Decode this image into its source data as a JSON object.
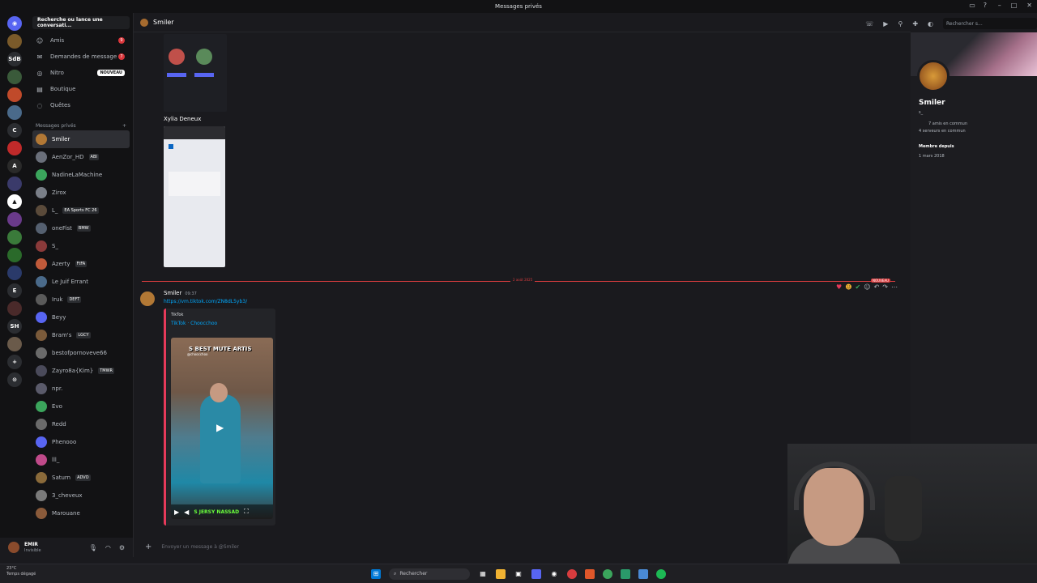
{
  "window": {
    "title": "Messages privés"
  },
  "servers": [
    "SdB",
    "C",
    "E",
    "SH"
  ],
  "sidebar": {
    "search_placeholder": "Recherche ou lance une conversati...",
    "nav": [
      {
        "label": "Amis",
        "badge": "9"
      },
      {
        "label": "Demandes de message",
        "badge": "7"
      },
      {
        "label": "Nitro",
        "badge": "NOUVEAU"
      },
      {
        "label": "Boutique"
      },
      {
        "label": "Quêtes"
      }
    ],
    "section_title": "Messages privés",
    "dms": [
      {
        "name": "Smiler",
        "tag": "",
        "color": "#b27835"
      },
      {
        "name": "AenZor_HD",
        "tag": "ABI",
        "color": "#6a6f7a"
      },
      {
        "name": "NadineLaMachine",
        "tag": "",
        "color": "#3ba55c"
      },
      {
        "name": "Zirox",
        "tag": "",
        "color": "#7a7f88"
      },
      {
        "name": "L_",
        "tag": "EA Sports FC 26",
        "color": "#5a4a3a"
      },
      {
        "name": "oneFist",
        "tag": "BMW",
        "color": "#556070"
      },
      {
        "name": "S_",
        "tag": "",
        "color": "#8a3a3a"
      },
      {
        "name": "Azerty",
        "tag": "FtFA",
        "color": "#c05a3a"
      },
      {
        "name": "Le Juif Errant",
        "tag": "",
        "color": "#4a6a8a"
      },
      {
        "name": "Iruk",
        "tag": "DEFT",
        "color": "#5a5a5a"
      },
      {
        "name": "Beyy",
        "tag": "",
        "color": "#5865f2"
      },
      {
        "name": "Bram's",
        "tag": "LGCY",
        "color": "#7a5a3a"
      },
      {
        "name": "bestofpornoveve66",
        "tag": "",
        "color": "#6a6a6a"
      },
      {
        "name": "Zayro8a{Kim}",
        "tag": "TMWR",
        "color": "#4a4a5a"
      },
      {
        "name": "npr.",
        "tag": "",
        "color": "#5a5a6a"
      },
      {
        "name": "Evo",
        "tag": "",
        "color": "#3ba55c"
      },
      {
        "name": "Redd",
        "tag": "",
        "color": "#6a6a6a"
      },
      {
        "name": "Phenooo",
        "tag": "",
        "color": "#5865f2"
      },
      {
        "name": "lll_",
        "tag": "",
        "color": "#c04a8a"
      },
      {
        "name": "Saturn",
        "tag": "ADVO",
        "color": "#8a6a3a"
      },
      {
        "name": "3_cheveux",
        "tag": "",
        "color": "#7a7a7a"
      },
      {
        "name": "Marouane",
        "tag": "",
        "color": "#8a5a3a"
      }
    ]
  },
  "userbar": {
    "name": "EMIR",
    "status": "Invisible"
  },
  "chat": {
    "title": "Smiler",
    "search_placeholder": "Rechercher s...",
    "prev_name": "Xylia Deneux",
    "date_divider": "2 août 2025",
    "new_label": "NOUVEAU",
    "message": {
      "author": "Smiler",
      "time": "09:37",
      "link": "https://vm.tiktok.com/ZN8dL5yb3/",
      "provider": "TikTok",
      "embed_title": "TikTok · Choocchoo",
      "video_caption": "S BEST MUTE ARTIS",
      "video_handle": "@choocchoo",
      "subtitle": "S JERSY NASSAD"
    },
    "composer_placeholder": "Envoyer un message à @Smiler"
  },
  "profile": {
    "name": "Smiler",
    "handle": "s_",
    "mutual_friends": "7 amis en commun",
    "mutual_servers": "4 serveurs en commun",
    "member_since_label": "Membre depuis",
    "member_since": "1 mars 2018"
  },
  "taskbar": {
    "weather_temp": "23°C",
    "weather_desc": "Temps dégagé",
    "search": "Rechercher"
  }
}
